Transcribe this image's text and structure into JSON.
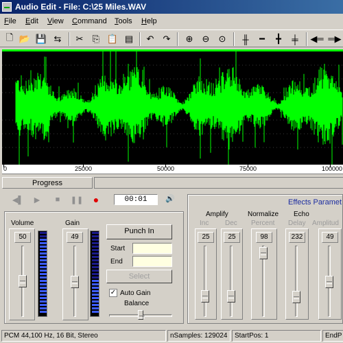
{
  "window": {
    "title": "Audio Edit - File: C:\\25 Miles.WAV"
  },
  "menu": {
    "items": [
      "File",
      "Edit",
      "View",
      "Command",
      "Tools",
      "Help"
    ]
  },
  "toolbar": {
    "buttons": [
      "new-icon",
      "open-icon",
      "save-icon",
      "properties-icon",
      "cut-icon",
      "copy-icon",
      "paste-icon",
      "paste-special-icon",
      "undo-icon",
      "redo-icon",
      "zoom-in-icon",
      "zoom-out-icon",
      "zoom-fit-icon",
      "waveform-icon",
      "flatten-icon",
      "cross-icon",
      "marker-icon",
      "play-back-icon",
      "play-forward-icon"
    ]
  },
  "waveform": {
    "color": "#00ff00",
    "background": "#000000"
  },
  "ruler": {
    "labels": [
      "0",
      "25000",
      "50000",
      "75000",
      "100000"
    ]
  },
  "progress": {
    "tab_label": "Progress",
    "value": 0
  },
  "transport": {
    "time": "00:01",
    "record_color": "#e00000"
  },
  "volume": {
    "label": "Volume",
    "value": "50",
    "level_fraction": 0.5,
    "meter_level": 0.95
  },
  "gain": {
    "label": "Gain",
    "value": "49",
    "level_fraction": 0.49,
    "meter_level": 0.45
  },
  "punch": {
    "punch_in_label": "Punch In",
    "start_label": "Start",
    "end_label": "End",
    "start_value": "",
    "end_value": "",
    "select_label": "Select",
    "auto_gain_label": "Auto Gain",
    "auto_gain_checked": true,
    "balance_label": "Balance",
    "balance_fraction": 0.5
  },
  "effects": {
    "title": "Effects Paramet",
    "groups": [
      {
        "name": "Amplify",
        "params": [
          {
            "label": "Inc",
            "value": "25",
            "level_fraction": 0.25
          },
          {
            "label": "Dec",
            "value": "25",
            "level_fraction": 0.25
          }
        ]
      },
      {
        "name": "Normalize",
        "params": [
          {
            "label": "Percent",
            "value": "98",
            "level_fraction": 0.98
          }
        ]
      },
      {
        "name": "Echo",
        "params": [
          {
            "label": "Delay",
            "value": "232",
            "level_fraction": 0.23
          },
          {
            "label": "Amplitud",
            "value": "49",
            "level_fraction": 0.49
          }
        ]
      }
    ]
  },
  "status": {
    "format": "PCM 44,100 Hz, 16 Bit, Stereo",
    "samples": "nSamples: 129024",
    "start_pos": "StartPos: 1",
    "end_pos": "EndP"
  }
}
